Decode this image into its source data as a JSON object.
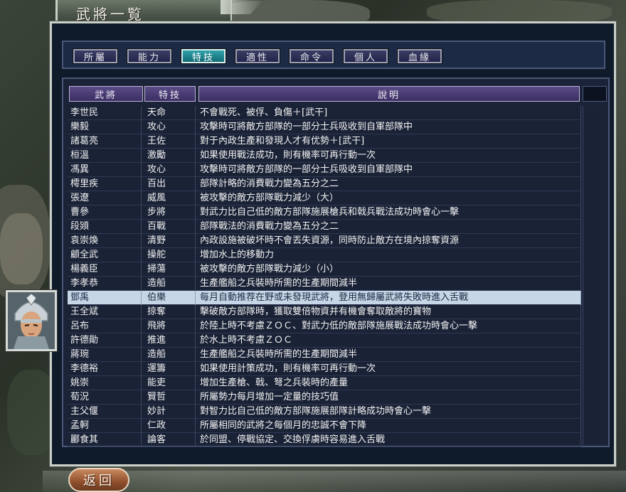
{
  "window_title": "武將一覧",
  "tabs": [
    {
      "label": "所屬",
      "active": false
    },
    {
      "label": "能力",
      "active": false
    },
    {
      "label": "特技",
      "active": true
    },
    {
      "label": "適性",
      "active": false
    },
    {
      "label": "命令",
      "active": false
    },
    {
      "label": "個人",
      "active": false
    },
    {
      "label": "血緣",
      "active": false
    }
  ],
  "columns": {
    "name": "武將",
    "skill": "特技",
    "desc": "說明"
  },
  "rows": [
    {
      "name": "李世民",
      "skill": "天命",
      "desc": "不會戰死、被俘、負傷＋[武干]"
    },
    {
      "name": "樂毅",
      "skill": "攻心",
      "desc": "攻擊時可將敵方部隊的一部分士兵吸收到自軍部隊中"
    },
    {
      "name": "諸葛亮",
      "skill": "王佐",
      "desc": "對于內政生產和發現人才有优勢＋[武干]"
    },
    {
      "name": "桓溫",
      "skill": "激勵",
      "desc": "如果使用戰法成功，則有機率可再行動一次"
    },
    {
      "name": "馮異",
      "skill": "攻心",
      "desc": "攻擊時可將敵方部隊的一部分士兵吸收到自軍部隊中"
    },
    {
      "name": "樗里疾",
      "skill": "百出",
      "desc": "部隊計略的消費戰力變為五分之二"
    },
    {
      "name": "張遼",
      "skill": "威風",
      "desc": "被攻擊的敵方部隊戰力減少（大）"
    },
    {
      "name": "曹參",
      "skill": "步將",
      "desc": "對武力比自己低的敵方部隊施展槍兵和戟兵戰法成功時會心一擊"
    },
    {
      "name": "段熲",
      "skill": "百戰",
      "desc": "部隊戰法的消費戰力變為五分之二"
    },
    {
      "name": "袁崇煥",
      "skill": "清野",
      "desc": "內政設施被破坏時不會丟失資源，同時防止敵方在境內掠奪資源"
    },
    {
      "name": "顧全武",
      "skill": "操舵",
      "desc": "增加水上的移動力"
    },
    {
      "name": "楊義臣",
      "skill": "掃蕩",
      "desc": "被攻擊的敵方部隊戰力減少（小）"
    },
    {
      "name": "李孝恭",
      "skill": "造船",
      "desc": "生產艦船之兵裝時所需的生產期間減半"
    },
    {
      "name": "鄧禹",
      "skill": "伯樂",
      "desc": "每月自動推荐在野或未發現武將，登用無歸屬武將失敗時進入舌戰",
      "selected": true
    },
    {
      "name": "王全斌",
      "skill": "掠奪",
      "desc": "擊破敵方部隊時，獲取雙倍物資并有機會奪取敵將的寶物"
    },
    {
      "name": "呂布",
      "skill": "飛將",
      "desc": "於陸上時不考慮ＺＯＣ、對武力低的敵部隊施展戰法成功時會心一擊"
    },
    {
      "name": "許德勛",
      "skill": "推進",
      "desc": "於水上時不考慮ＺＯＣ"
    },
    {
      "name": "蔣琬",
      "skill": "造船",
      "desc": "生產艦船之兵裝時所需的生產期間減半"
    },
    {
      "name": "李德裕",
      "skill": "運籌",
      "desc": "如果使用計策成功，則有機率可再行動一次"
    },
    {
      "name": "姚崇",
      "skill": "能吏",
      "desc": "增加生產槍、戟、弩之兵裝時的產量"
    },
    {
      "name": "荀況",
      "skill": "賢哲",
      "desc": "所屬勢力每月增加一定量的技巧值"
    },
    {
      "name": "主父偃",
      "skill": "妙計",
      "desc": "對智力比自己低的敵方部隊施展部隊計略成功時會心一擊"
    },
    {
      "name": "孟軻",
      "skill": "仁政",
      "desc": "所屬相同的武將之每個月的忠誠不會下降"
    },
    {
      "name": "酈食其",
      "skill": "論客",
      "desc": "於同盟、停戰協定、交換俘虜時容易進入舌戰"
    }
  ],
  "return_label": "返回",
  "colors": {
    "selected_row": "#c6d6e6",
    "active_tab": "#2fa2aa",
    "header": "#4a3d78"
  }
}
